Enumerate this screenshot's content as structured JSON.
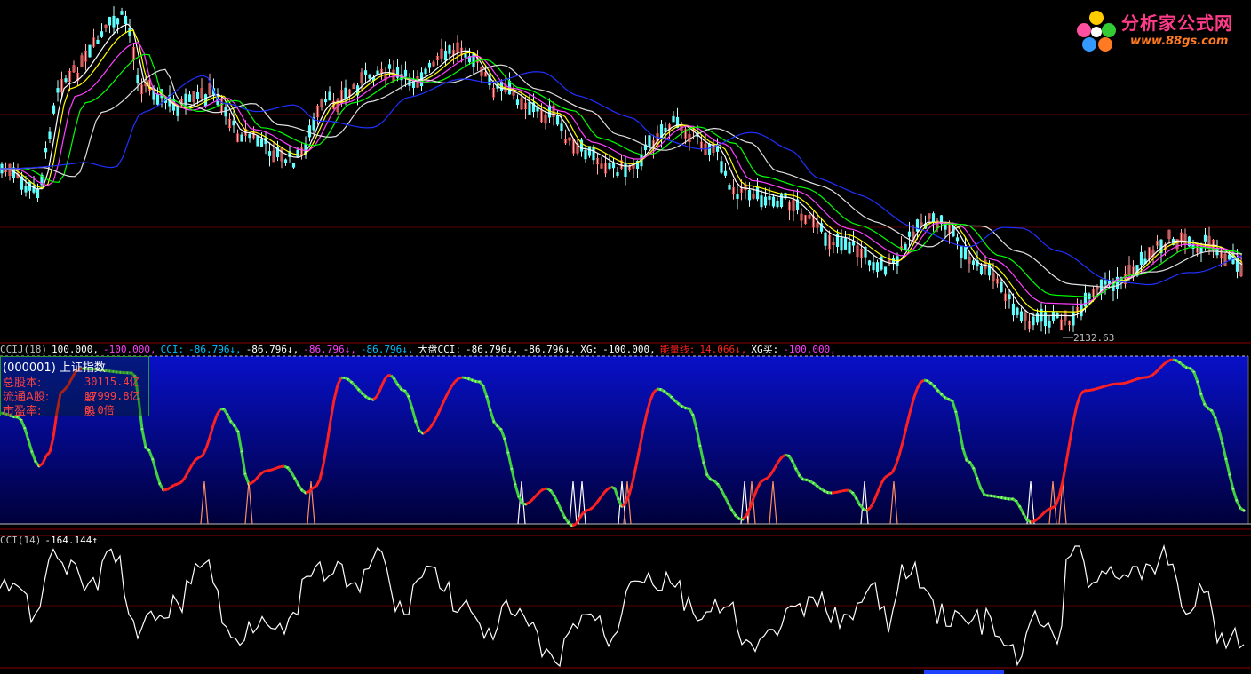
{
  "colors": {
    "background": "#000000",
    "divider": "#8b0000",
    "ma5": "#ffffff",
    "ma10": "#ffff00",
    "ma20": "#ff40ff",
    "ma30": "#00ff00",
    "ma60": "#e0e0e0",
    "ma120": "#2030ff",
    "cci_up": "#ff2020",
    "cci_down": "#40d040",
    "panel_top": "#0810c8",
    "panel_bottom": "#00003a"
  },
  "price_panel": {
    "low_marker": "2132.63"
  },
  "indicator_header": {
    "items": [
      {
        "text": "CCIJ(18)",
        "color": "#c0c0c0"
      },
      {
        "text": "100.000,",
        "color": "#ffffff"
      },
      {
        "text": "-100.000,",
        "color": "#ff40ff"
      },
      {
        "text": "CCI:",
        "color": "#00c0ff"
      },
      {
        "text": "-86.796↓,",
        "color": "#00c0ff"
      },
      {
        "text": "-86.796↓,",
        "color": "#ffffff"
      },
      {
        "text": "-86.796↓,",
        "color": "#ff40ff"
      },
      {
        "text": "-86.796↓,",
        "color": "#00c0ff"
      },
      {
        "text": "大盘CCI:",
        "color": "#ffffff"
      },
      {
        "text": "-86.796↓,",
        "color": "#ffffff"
      },
      {
        "text": "-86.796↓,",
        "color": "#ffffff"
      },
      {
        "text": "XG:",
        "color": "#ffffff"
      },
      {
        "text": "-100.000,",
        "color": "#ffffff"
      },
      {
        "text": "能量线:",
        "color": "#ff2020"
      },
      {
        "text": "14.066↓,",
        "color": "#ff2020"
      },
      {
        "text": "XG买:",
        "color": "#ffffff"
      },
      {
        "text": "-100.000,",
        "color": "#ff40ff"
      }
    ]
  },
  "info_box": {
    "title": "(000001) 上证指数",
    "rows": [
      {
        "label": "总股本:",
        "value": "30115.4亿股"
      },
      {
        "label": "流通A股:",
        "value": "17999.8亿股"
      },
      {
        "label": "市盈率:",
        "value": "0.0倍"
      }
    ]
  },
  "cci14_header": {
    "label": "CCI(14)",
    "value": "-164.144↑"
  },
  "logo": {
    "title": "分析家公式网",
    "subtitle": "www.88gs.com"
  }
}
